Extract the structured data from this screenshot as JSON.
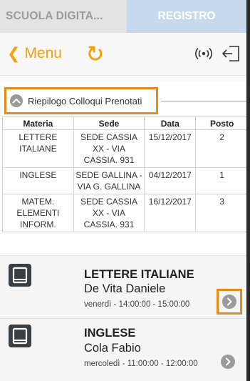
{
  "tabs": {
    "left_label": "SCUOLA DIGITA...",
    "right_label": "REGISTRO"
  },
  "navbar": {
    "back_chevron": "❮",
    "menu_label": "Menu",
    "icons": [
      "refresh-icon",
      "signal-icon",
      "logout-icon"
    ]
  },
  "summary": {
    "title": "Riepilogo Colloqui Prenotati",
    "columns": [
      "Materia",
      "Sede",
      "Data",
      "Posto"
    ],
    "rows": [
      {
        "materia": "LETTERE ITALIANE",
        "sede": "SEDE CASSIA XX - VIA CASSIA. 931",
        "data": "15/12/2017",
        "posto": "2"
      },
      {
        "materia": "INGLESE",
        "sede": "SEDE GALLINA - VIA G. GALLINA",
        "data": "04/12/2017",
        "posto": "1"
      },
      {
        "materia": "MATEM. ELEMENTI INFORM.",
        "sede": "SEDE CASSIA XX - VIA CASSIA. 931",
        "data": "16/12/2017",
        "posto": "3"
      }
    ]
  },
  "list": {
    "items": [
      {
        "subject": "LETTERE ITALIANE",
        "teacher": "De Vita Daniele",
        "slot": "venerdì - 14:00:00 - 15:00:00"
      },
      {
        "subject": "INGLESE",
        "teacher": "Cola Fabio",
        "slot": "mercoledì - 11:00:00 - 12:00:00"
      }
    ]
  },
  "colors": {
    "accent_orange": "#f2a10f",
    "highlight_border": "#e98a14",
    "tab_inactive": "#e3e3e3",
    "tab_active": "#c7d9ec"
  }
}
